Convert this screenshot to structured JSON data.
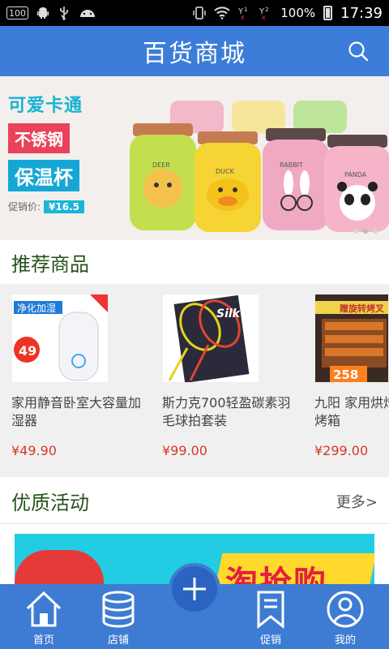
{
  "status_bar": {
    "left_icons": [
      "battery-100-icon",
      "android-icon",
      "usb-icon",
      "android-icon"
    ],
    "right_icons": [
      "vibrate-icon",
      "wifi-icon",
      "signal-icon",
      "signal-2-icon"
    ],
    "battery_percent": "100%",
    "time": "17:39"
  },
  "header": {
    "title": "百货商城",
    "search_icon": "search-icon",
    "bg_color": "#3b7dd8"
  },
  "banner": {
    "line1": "可爱卡通",
    "line2": "不锈钢",
    "line3": "保温杯",
    "price_label": "促销价:",
    "price_value": "¥16.5",
    "cup_labels": [
      "DEER",
      "DUCK",
      "RABBIT",
      "PANDA"
    ],
    "dots": 3,
    "active_dot": 1
  },
  "recommended": {
    "title": "推荐商品",
    "items": [
      {
        "name": "家用静音卧室大容量加湿器",
        "price": "¥49.90",
        "img_text": "净化加湿",
        "img_badge": "49"
      },
      {
        "name": "斯力克700轻盈碳素羽毛球拍套装",
        "price": "¥99.00",
        "img_text": "Silk"
      },
      {
        "name": "九阳 家用烘焙多功能电烤箱",
        "price": "¥299.00",
        "img_text": "赠旋转烤叉",
        "img_badge": "258"
      }
    ]
  },
  "activities": {
    "title": "优质活动",
    "more_label": "更多>",
    "promo_text": "淘抢购"
  },
  "tabbar": {
    "items": [
      {
        "label": "首页",
        "icon": "home-icon"
      },
      {
        "label": "店铺",
        "icon": "database-icon"
      },
      {
        "label": "",
        "icon": "plus-icon"
      },
      {
        "label": "促销",
        "icon": "bookmark-icon"
      },
      {
        "label": "我的",
        "icon": "user-icon"
      }
    ],
    "bg_color": "#3e7cd3"
  }
}
